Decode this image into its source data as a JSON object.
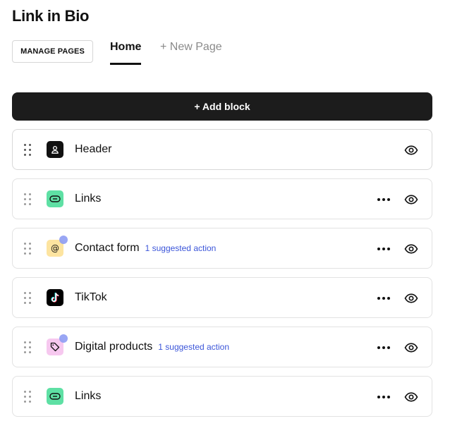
{
  "page_title": "Link in Bio",
  "manage_pages_label": "MANAGE PAGES",
  "tabs": {
    "home": "Home",
    "new_page": "+ New Page"
  },
  "add_block_label": "+ Add block",
  "blocks": [
    {
      "label": "Header",
      "icon": "person-icon",
      "icon_bg": "#111111",
      "suggestion": "",
      "has_menu": false
    },
    {
      "label": "Links",
      "icon": "link-icon",
      "icon_bg": "#5ee0a4",
      "suggestion": "",
      "has_menu": true
    },
    {
      "label": "Contact form",
      "icon": "at-sign-icon",
      "icon_bg": "#fde4a0",
      "suggestion": "1 suggested action",
      "has_menu": true
    },
    {
      "label": "TikTok",
      "icon": "tiktok-icon",
      "icon_bg": "#000000",
      "suggestion": "",
      "has_menu": true
    },
    {
      "label": "Digital products",
      "icon": "tag-icon",
      "icon_bg": "#f6c8ef",
      "suggestion": "1 suggested action",
      "has_menu": true
    },
    {
      "label": "Links",
      "icon": "link-icon",
      "icon_bg": "#5ee0a4",
      "suggestion": "",
      "has_menu": true
    }
  ],
  "colors": {
    "accent_dark": "#1c1c1c",
    "suggestion_link": "#3b55d9",
    "badge_dot": "#8e9cf3"
  }
}
